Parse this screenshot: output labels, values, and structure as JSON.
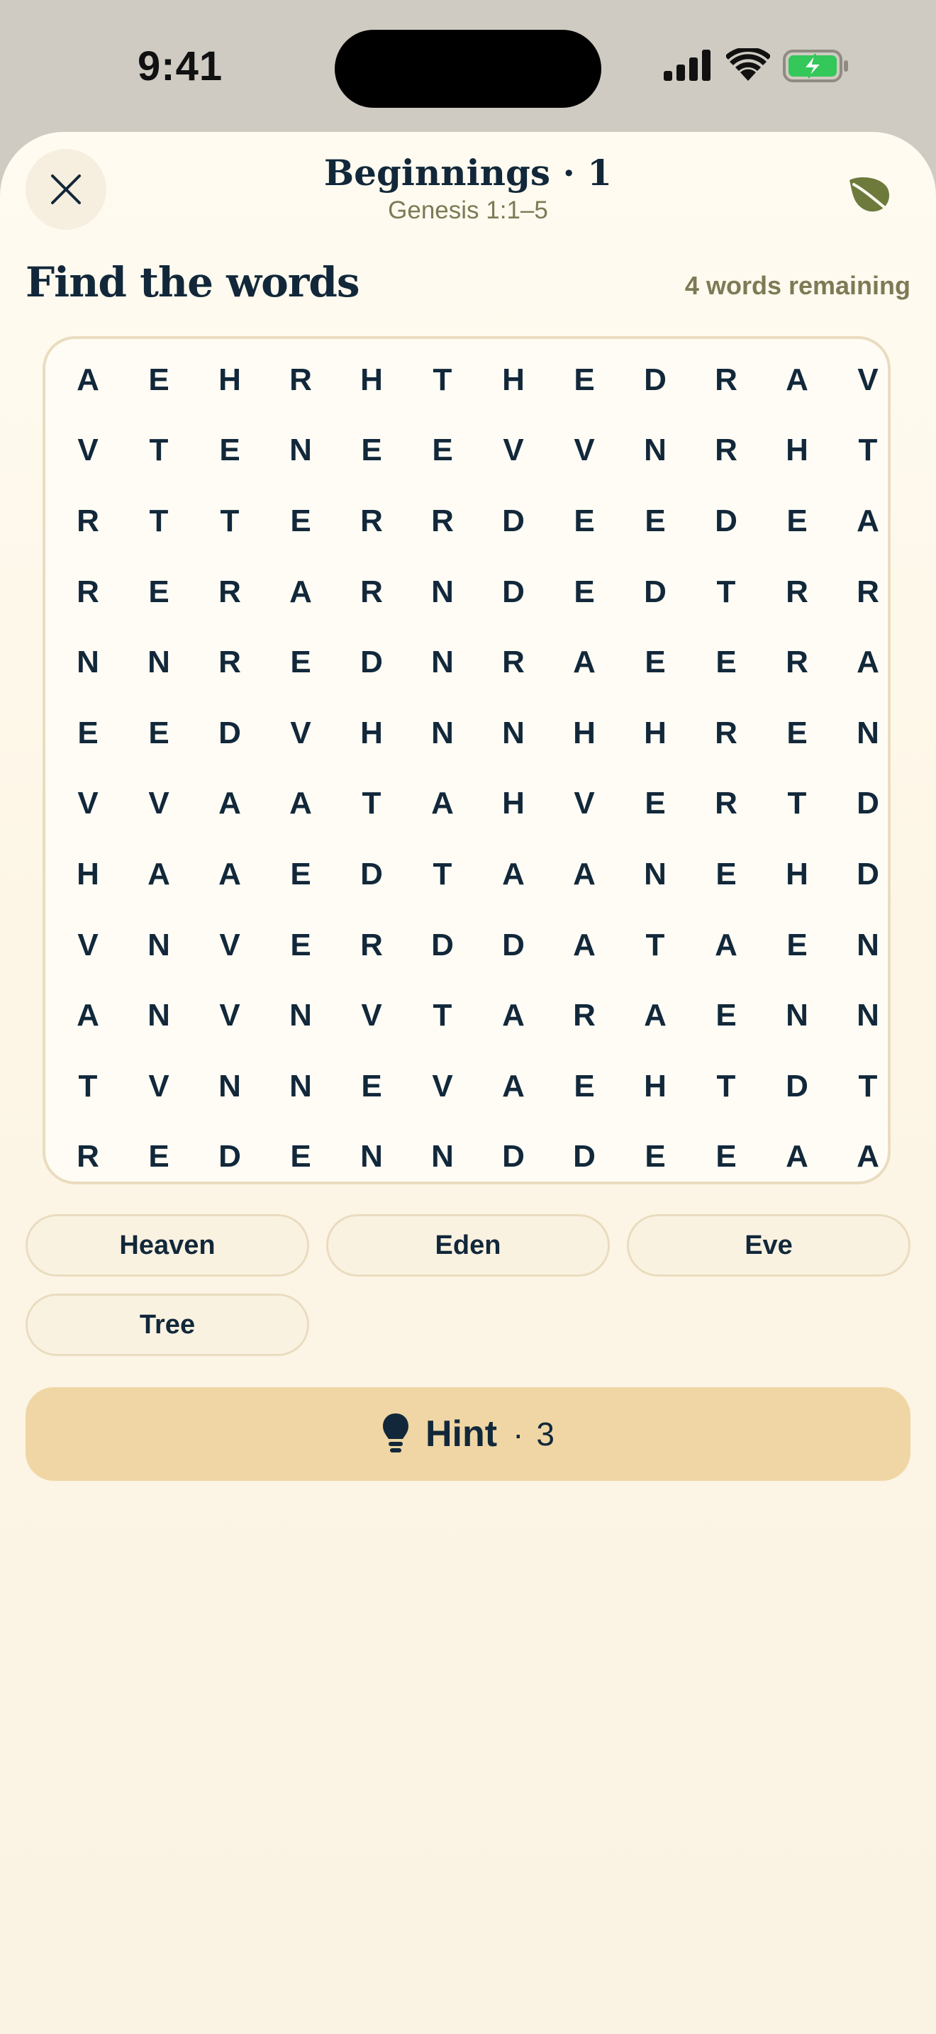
{
  "status_bar": {
    "time": "9:41"
  },
  "header": {
    "title": "Beginnings · 1",
    "subtitle": "Genesis 1:1–5",
    "heading": "Find the words",
    "remaining": "4 words remaining"
  },
  "grid": {
    "rows": [
      [
        "A",
        "E",
        "H",
        "R",
        "H",
        "T",
        "H",
        "E",
        "D",
        "R",
        "A",
        "V"
      ],
      [
        "V",
        "T",
        "E",
        "N",
        "E",
        "E",
        "V",
        "V",
        "N",
        "R",
        "H",
        "T"
      ],
      [
        "R",
        "T",
        "T",
        "E",
        "R",
        "R",
        "D",
        "E",
        "E",
        "D",
        "E",
        "A"
      ],
      [
        "R",
        "E",
        "R",
        "A",
        "R",
        "N",
        "D",
        "E",
        "D",
        "T",
        "R",
        "R"
      ],
      [
        "N",
        "N",
        "R",
        "E",
        "D",
        "N",
        "R",
        "A",
        "E",
        "E",
        "R",
        "A"
      ],
      [
        "E",
        "E",
        "D",
        "V",
        "H",
        "N",
        "N",
        "H",
        "H",
        "R",
        "E",
        "N"
      ],
      [
        "V",
        "V",
        "A",
        "A",
        "T",
        "A",
        "H",
        "V",
        "E",
        "R",
        "T",
        "D"
      ],
      [
        "H",
        "A",
        "A",
        "E",
        "D",
        "T",
        "A",
        "A",
        "N",
        "E",
        "H",
        "D"
      ],
      [
        "V",
        "N",
        "V",
        "E",
        "R",
        "D",
        "D",
        "A",
        "T",
        "A",
        "E",
        "N"
      ],
      [
        "A",
        "N",
        "V",
        "N",
        "V",
        "T",
        "A",
        "R",
        "A",
        "E",
        "N",
        "N"
      ],
      [
        "T",
        "V",
        "N",
        "N",
        "E",
        "V",
        "A",
        "E",
        "H",
        "T",
        "D",
        "T"
      ],
      [
        "R",
        "E",
        "D",
        "E",
        "N",
        "N",
        "D",
        "D",
        "E",
        "E",
        "A",
        "A"
      ]
    ]
  },
  "words": [
    "Heaven",
    "Eden",
    "Eve",
    "Tree"
  ],
  "hint": {
    "label": "Hint",
    "separator": "·",
    "count": "3"
  },
  "colors": {
    "accent": "#efd6a4",
    "ink": "#12283a",
    "olive": "#7d7a55",
    "leaf": "#6d7a3c"
  }
}
